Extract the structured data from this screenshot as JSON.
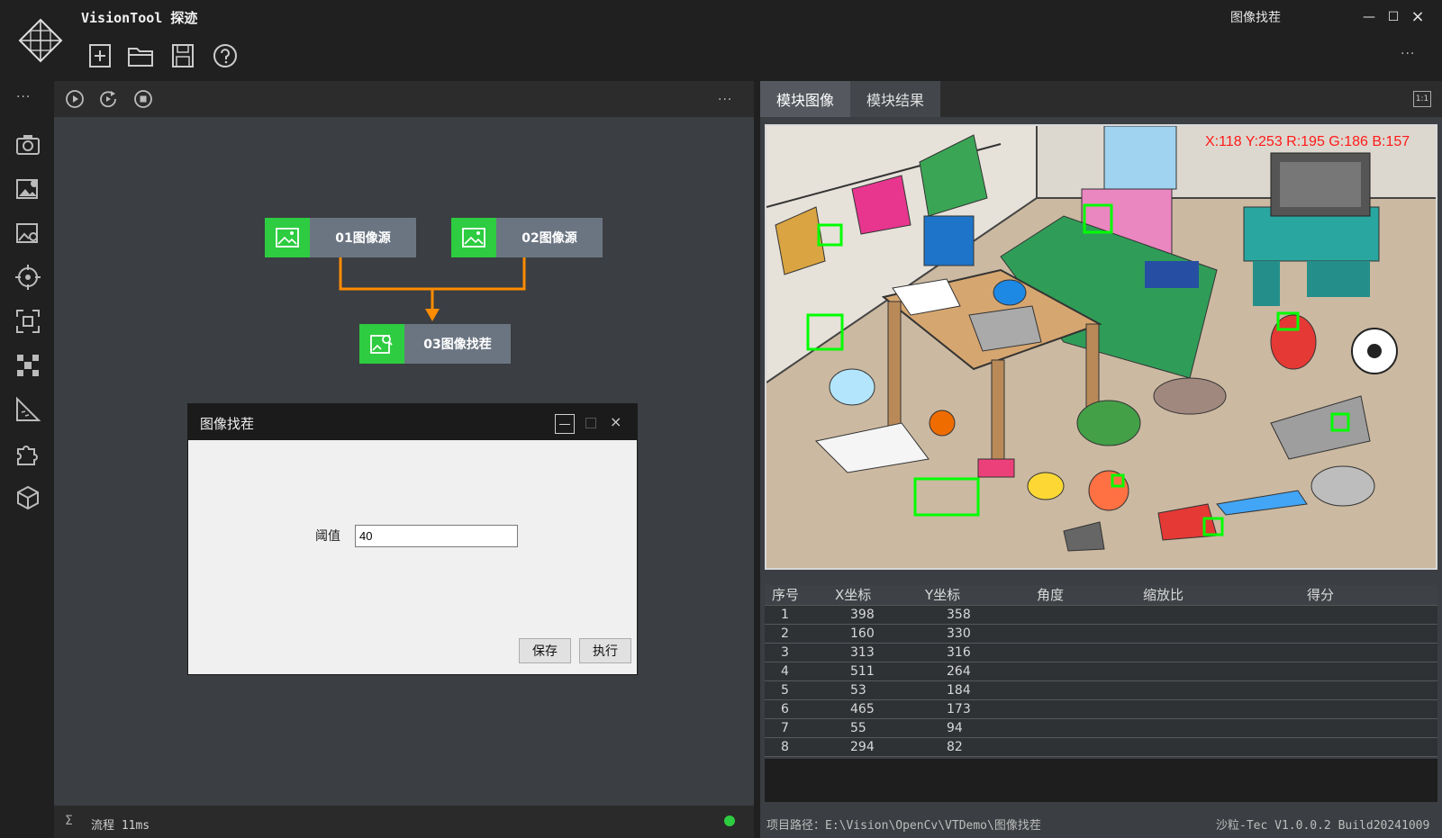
{
  "app": {
    "title": "VisionTool 探迹",
    "window_title": "图像找茬"
  },
  "window_controls": {
    "minimize": "—",
    "maximize": "☐",
    "close": "×"
  },
  "toolbar": {
    "more": "···"
  },
  "sidebar": {
    "more": "···",
    "icons": [
      "camera-icon",
      "image-settings-icon",
      "image-search-icon",
      "crosshair-icon",
      "focus-frame-icon",
      "grid-pattern-icon",
      "ruler-icon",
      "puzzle-icon",
      "cube-icon"
    ]
  },
  "flow": {
    "more": "···",
    "nodes": [
      {
        "label": "01图像源"
      },
      {
        "label": "02图像源"
      },
      {
        "label": "03图像找茬"
      }
    ]
  },
  "dialog": {
    "title": "图像找茬",
    "threshold_label": "阈值",
    "threshold_value": "40",
    "save_label": "保存",
    "run_label": "执行",
    "close_glyph": "×"
  },
  "tabs": [
    {
      "label": "模块图像"
    },
    {
      "label": "模块结果"
    }
  ],
  "ratio_label": "1:1",
  "pixel_readout": "X:118 Y:253  R:195 G:186 B:157",
  "results": {
    "columns": [
      "序号",
      "X坐标",
      "Y坐标",
      "角度",
      "缩放比",
      "得分"
    ],
    "rows": [
      [
        "1",
        "398",
        "358",
        "",
        "",
        ""
      ],
      [
        "2",
        "160",
        "330",
        "",
        "",
        ""
      ],
      [
        "3",
        "313",
        "316",
        "",
        "",
        ""
      ],
      [
        "4",
        "511",
        "264",
        "",
        "",
        ""
      ],
      [
        "5",
        "53",
        "184",
        "",
        "",
        ""
      ],
      [
        "6",
        "465",
        "173",
        "",
        "",
        ""
      ],
      [
        "7",
        "55",
        "94",
        "",
        "",
        ""
      ],
      [
        "8",
        "294",
        "82",
        "",
        "",
        ""
      ]
    ]
  },
  "status": {
    "sigma": "Σ",
    "flow_time": "流程 11ms",
    "project_path": "项目路径：E:\\Vision\\OpenCv\\VTDemo\\图像找茬",
    "version": "沙粒-Tec V1.0.0.2 Build20241009"
  },
  "colors": {
    "node_green": "#2ecc40",
    "connector": "#ff8c00",
    "marker": "#00ff00",
    "readout": "#ff1a1a"
  }
}
